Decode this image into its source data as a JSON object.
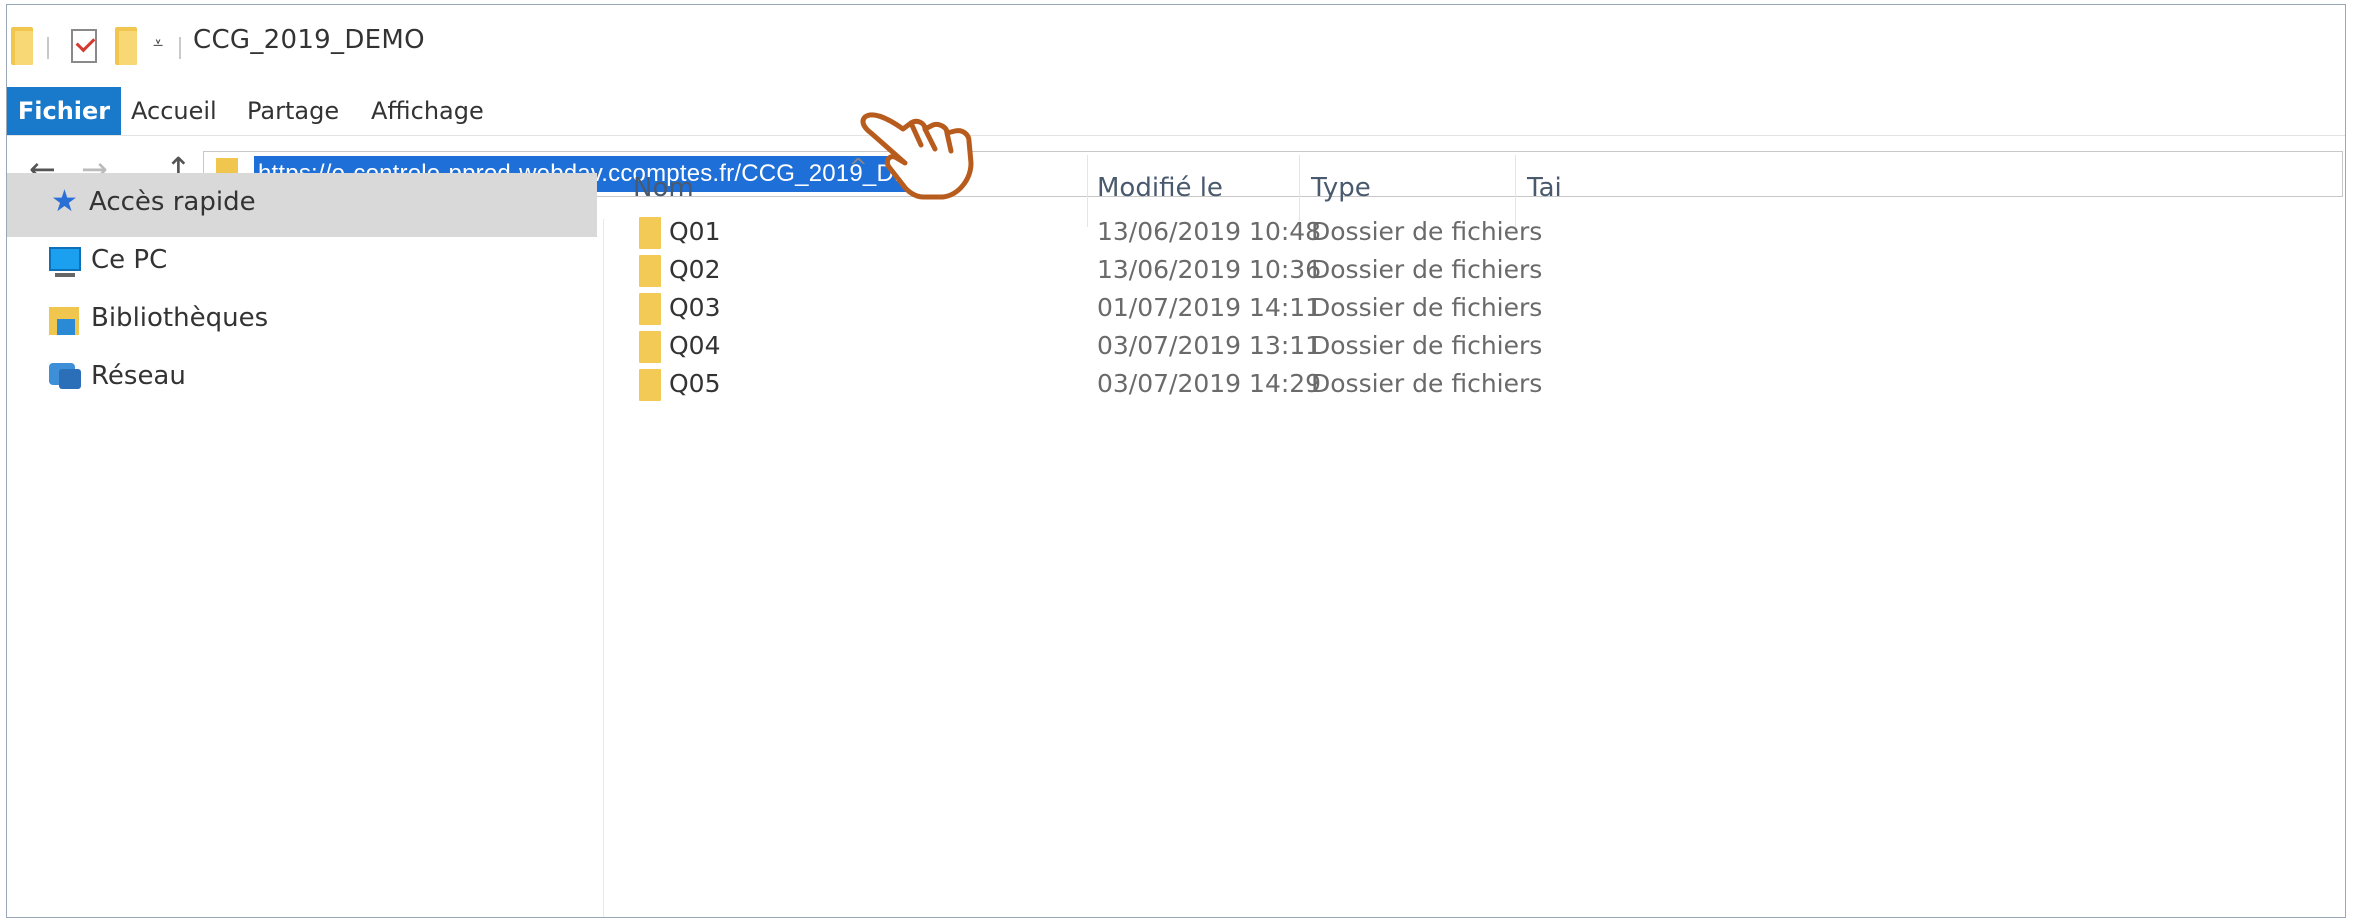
{
  "window": {
    "title": "CCG_2019_DEMO"
  },
  "quick_access_toolbar": {
    "icons": [
      "folder-icon",
      "properties-icon",
      "new-folder-icon",
      "customize-dropdown-icon"
    ]
  },
  "ribbon": {
    "tabs": [
      {
        "label": "Fichier",
        "active": true
      },
      {
        "label": "Accueil"
      },
      {
        "label": "Partage"
      },
      {
        "label": "Affichage"
      }
    ]
  },
  "navigation": {
    "back": "←",
    "forward": "→",
    "recent": "⌄",
    "up": "↑"
  },
  "address_bar": {
    "value": "https://e-controle-pprod-webdav.ccomptes.fr/CCG_2019_DEMO",
    "selected": true
  },
  "sidebar": {
    "items": [
      {
        "label": "Accès rapide",
        "icon": "star-pin-icon",
        "selected": true
      },
      {
        "label": "Ce PC",
        "icon": "computer-icon"
      },
      {
        "label": "Bibliothèques",
        "icon": "libraries-icon"
      },
      {
        "label": "Réseau",
        "icon": "network-icon"
      }
    ]
  },
  "file_list": {
    "sort_indicator": "^",
    "columns": [
      "Nom",
      "Modifié le",
      "Type",
      "Tai"
    ],
    "rows": [
      {
        "name": "Q01",
        "modified": "13/06/2019 10:48",
        "type": "Dossier de fichiers"
      },
      {
        "name": "Q02",
        "modified": "13/06/2019 10:36",
        "type": "Dossier de fichiers"
      },
      {
        "name": "Q03",
        "modified": "01/07/2019 14:11",
        "type": "Dossier de fichiers"
      },
      {
        "name": "Q04",
        "modified": "03/07/2019 13:11",
        "type": "Dossier de fichiers"
      },
      {
        "name": "Q05",
        "modified": "03/07/2019 14:29",
        "type": "Dossier de fichiers"
      }
    ]
  },
  "colors": {
    "file_tab": "#1979ca",
    "selection": "#1e6fd8",
    "folder": "#f3ca55",
    "pointer_outline": "#b85c1e"
  }
}
